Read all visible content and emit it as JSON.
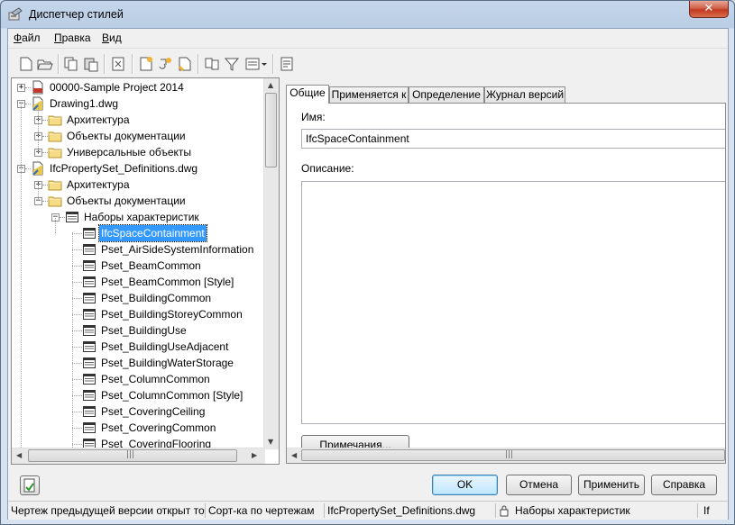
{
  "window": {
    "title": "Диспетчер стилей",
    "close_label": "✕"
  },
  "menu": [
    {
      "label": "Файл",
      "underline": "Ф"
    },
    {
      "label": "Правка",
      "underline": "П"
    },
    {
      "label": "Вид",
      "underline": "В"
    }
  ],
  "toolbar": {
    "icons": [
      "new-icon",
      "open-icon",
      "copy-icon",
      "paste-icon",
      "purge-icon",
      "new-style-icon",
      "edit-style-icon",
      "set-current-icon",
      "toggle-view-icon",
      "filter-icon",
      "list-view-icon",
      "properties-icon"
    ]
  },
  "tree": {
    "items": [
      {
        "label": "00000-Sample Project 2014",
        "level": 0,
        "icon": "project-icon",
        "expander": "+"
      },
      {
        "label": "Drawing1.dwg",
        "level": 0,
        "icon": "drawing-icon",
        "expander": "−"
      },
      {
        "label": "Архитектура",
        "level": 1,
        "icon": "folder-icon",
        "expander": "+"
      },
      {
        "label": "Объекты документации",
        "level": 1,
        "icon": "folder-icon",
        "expander": "+"
      },
      {
        "label": "Универсальные объекты",
        "level": 1,
        "icon": "folder-icon",
        "expander": "+"
      },
      {
        "label": "IfcPropertySet_Definitions.dwg",
        "level": 0,
        "icon": "drawing-icon",
        "expander": "−"
      },
      {
        "label": "Архитектура",
        "level": 1,
        "icon": "folder-icon",
        "expander": "+"
      },
      {
        "label": "Объекты документации",
        "level": 1,
        "icon": "folder-icon",
        "expander": "−"
      },
      {
        "label": "Наборы характеристик",
        "level": 2,
        "icon": "propset-icon",
        "expander": "−"
      },
      {
        "label": "IfcSpaceContainment",
        "level": 3,
        "icon": "propset-icon",
        "selected": true
      },
      {
        "label": "Pset_AirSideSystemInformation",
        "level": 3,
        "icon": "propset-icon"
      },
      {
        "label": "Pset_BeamCommon",
        "level": 3,
        "icon": "propset-icon"
      },
      {
        "label": "Pset_BeamCommon [Style]",
        "level": 3,
        "icon": "propset-icon"
      },
      {
        "label": "Pset_BuildingCommon",
        "level": 3,
        "icon": "propset-icon"
      },
      {
        "label": "Pset_BuildingStoreyCommon",
        "level": 3,
        "icon": "propset-icon"
      },
      {
        "label": "Pset_BuildingUse",
        "level": 3,
        "icon": "propset-icon"
      },
      {
        "label": "Pset_BuildingUseAdjacent",
        "level": 3,
        "icon": "propset-icon"
      },
      {
        "label": "Pset_BuildingWaterStorage",
        "level": 3,
        "icon": "propset-icon"
      },
      {
        "label": "Pset_ColumnCommon",
        "level": 3,
        "icon": "propset-icon"
      },
      {
        "label": "Pset_ColumnCommon [Style]",
        "level": 3,
        "icon": "propset-icon"
      },
      {
        "label": "Pset_CoveringCeiling",
        "level": 3,
        "icon": "propset-icon"
      },
      {
        "label": "Pset_CoveringCommon",
        "level": 3,
        "icon": "propset-icon"
      },
      {
        "label": "Pset_CoveringFlooring",
        "level": 3,
        "icon": "propset-icon"
      }
    ]
  },
  "tabs": [
    {
      "label": "Общие",
      "active": true
    },
    {
      "label": "Применяется к",
      "active": false
    },
    {
      "label": "Определение",
      "active": false
    },
    {
      "label": "Журнал версий",
      "active": false
    }
  ],
  "general": {
    "name_label": "Имя:",
    "name_value": "IfcSpaceContainment",
    "description_label": "Описание:",
    "description_value": "",
    "notes_button": "Примечания..."
  },
  "buttons": {
    "ok": "OK",
    "cancel": "Отмена",
    "apply": "Применить",
    "help": "Справка"
  },
  "status": {
    "cell1": "Чертеж предыдущей версии открыт то",
    "cell2": "Сорт-ка по чертежам",
    "cell3": "IfcPropertySet_Definitions.dwg",
    "cell4": "Наборы характеристик",
    "cell5": "If"
  }
}
